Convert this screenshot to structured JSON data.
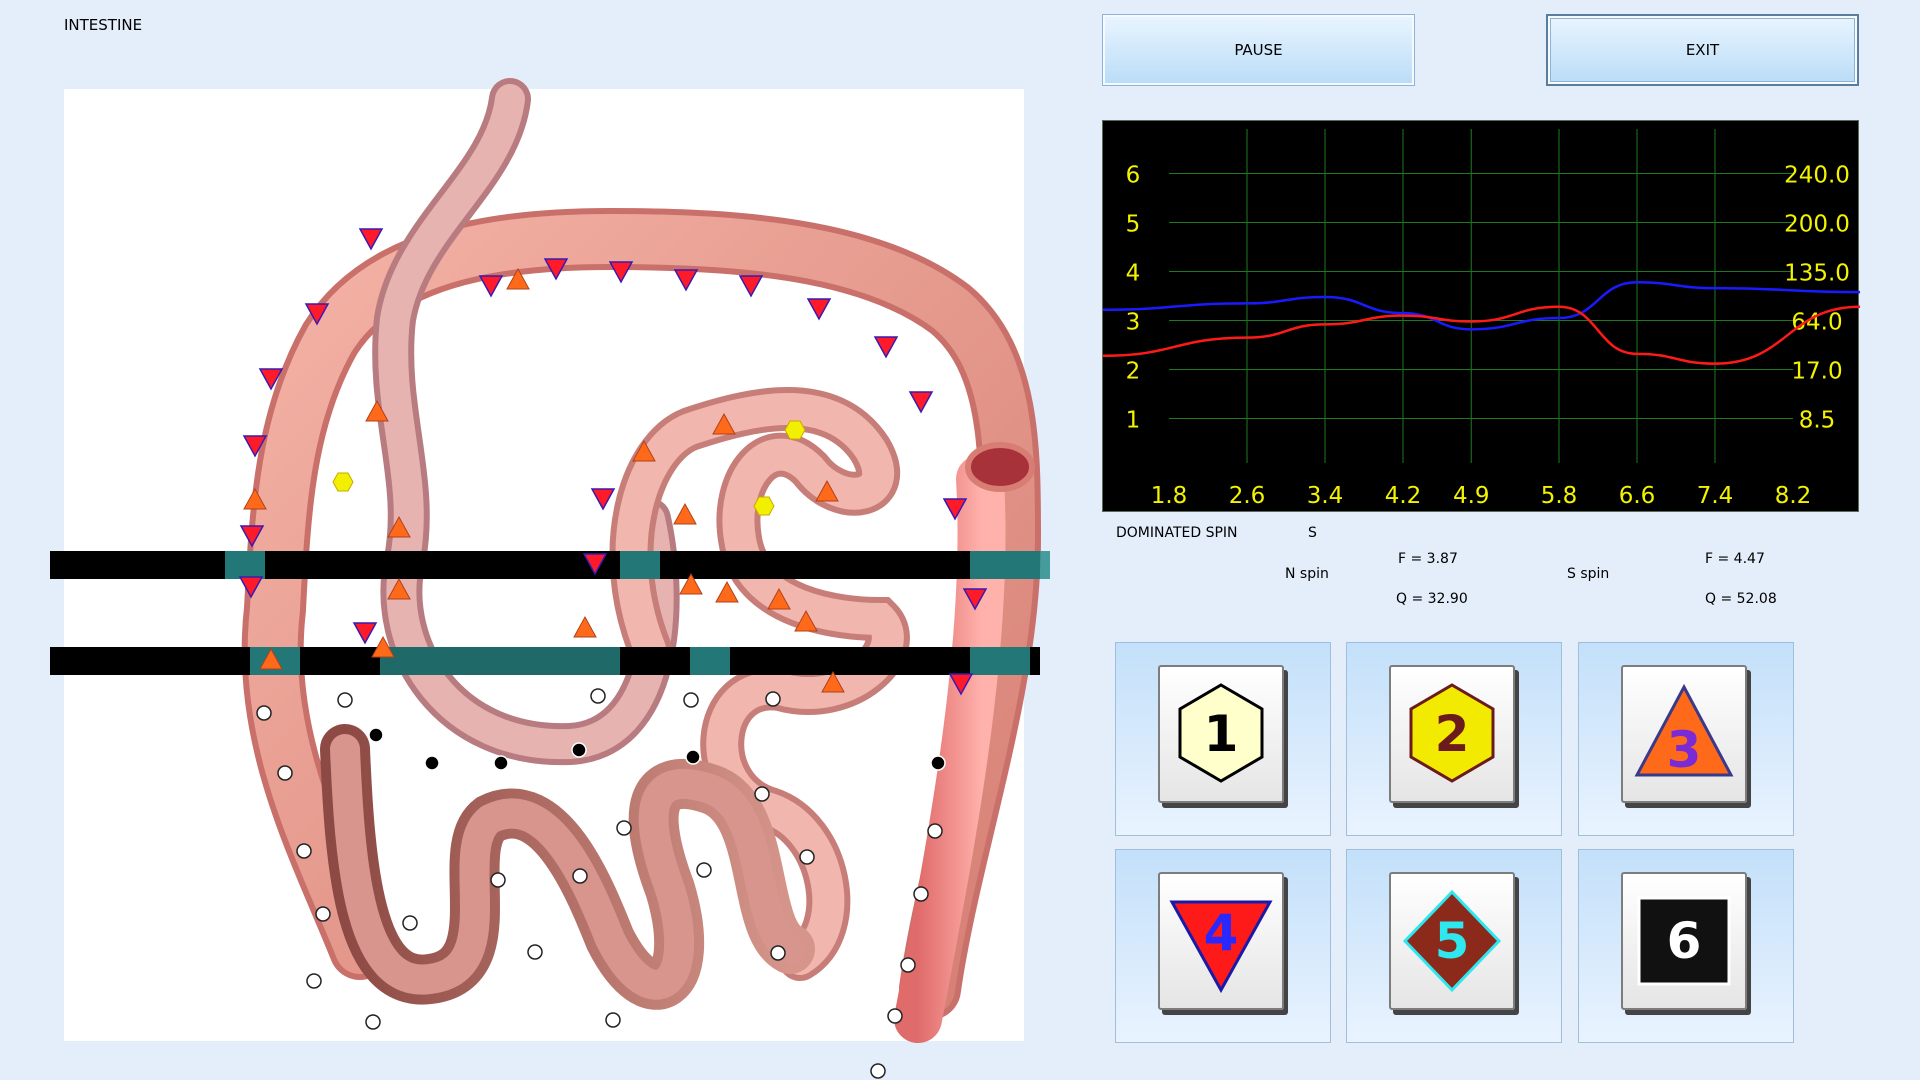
{
  "page": {
    "title": "INTESTINE"
  },
  "toolbar": {
    "pause_label": "PAUSE",
    "exit_label": "EXIT"
  },
  "chart_data": {
    "type": "line",
    "x_ticks": [
      "1.8",
      "2.6",
      "3.4",
      "4.2",
      "4.9",
      "5.8",
      "6.6",
      "7.4",
      "8.2"
    ],
    "y_left_ticks": [
      "6",
      "5",
      "4",
      "3",
      "2",
      "1"
    ],
    "y_right_ticks": [
      "240.0",
      "200.0",
      "135.0",
      "64.0",
      "17.0",
      "8.5"
    ],
    "ylim": [
      0.5,
      6.5
    ],
    "grid": true,
    "colors": {
      "background": "#000000",
      "grid": "#1f7a1f",
      "labels": "#f3f300"
    },
    "series": [
      {
        "color": "#1a1aff",
        "x": [
          1.8,
          2.6,
          3.4,
          4.2,
          4.9,
          5.8,
          6.6,
          7.4,
          8.2
        ],
        "y": [
          3.22,
          3.35,
          3.48,
          3.15,
          2.82,
          3.05,
          3.78,
          3.66,
          3.58
        ]
      },
      {
        "color": "#ff1a1a",
        "x": [
          1.8,
          2.6,
          3.4,
          4.2,
          4.9,
          5.8,
          6.6,
          7.4,
          8.2
        ],
        "y": [
          2.28,
          2.65,
          2.92,
          3.1,
          2.98,
          3.28,
          2.32,
          2.12,
          3.28
        ]
      }
    ]
  },
  "status": {
    "dominated_label": "DOMINATED SPIN",
    "dominated_value": "S",
    "n_spin_label": "N spin",
    "n_f": "F =  3.87",
    "n_q": "Q = 32.90",
    "s_spin_label": "S spin",
    "s_f": "F =  4.47",
    "s_q": "Q = 52.08"
  },
  "symbols": [
    {
      "label": "1",
      "shape": "hexagon",
      "fill": "#ffffcc",
      "text_color": "#000000",
      "stroke": "#000000"
    },
    {
      "label": "2",
      "shape": "hexagon",
      "fill": "#f2ea00",
      "text_color": "#6b1b1b",
      "stroke": "#6b1b1b"
    },
    {
      "label": "3",
      "shape": "triangle-up",
      "fill": "#ff6a1a",
      "text_color": "#7b2bd6",
      "stroke": "#3a3a8a"
    },
    {
      "label": "4",
      "shape": "triangle-down",
      "fill": "#ff1a1a",
      "text_color": "#2828ff",
      "stroke": "#1a1aaa"
    },
    {
      "label": "5",
      "shape": "diamond",
      "fill": "#8b2a1a",
      "text_color": "#2ee8f0",
      "stroke": "#2ee8f0"
    },
    {
      "label": "6",
      "shape": "square",
      "fill": "#111111",
      "text_color": "#ffffff",
      "stroke": "#ffffff"
    }
  ]
}
